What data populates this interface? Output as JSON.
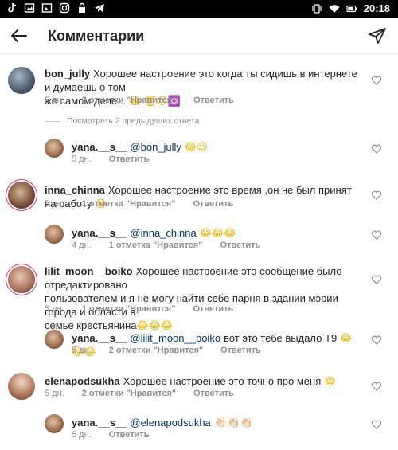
{
  "status_bar": {
    "time": "20:18",
    "icons": [
      "tiktok-icon",
      "gallery-icon",
      "picture-icon",
      "instagram-icon",
      "lock-icon",
      "telegram-icon"
    ],
    "right_icons": [
      "vibrate-icon",
      "wifi-icon",
      "battery-icon"
    ]
  },
  "header": {
    "title": "Комментарии"
  },
  "view_previous": "Посмотреть 2 предыдущих ответа",
  "comments": [
    {
      "user": "bon_jully",
      "text": "Хорошее настроение это когда ты сидишь в интернете и думаешь о том",
      "text2": "же самом деле...",
      "emoji": "😂 🗑😕🔯",
      "time": "5 дн.",
      "likes": "2 отметки \"Нравится\"",
      "reply": "Ответить"
    },
    {
      "user": "yana.__s__",
      "mention": "@bon_jully",
      "emoji": "😂😉",
      "time": "5 дн.",
      "reply": "Ответить"
    },
    {
      "user": "inna_chinna",
      "text": "Хорошее настроение это время ,он не был принят на работу",
      "emoji": "😂",
      "time": "5 дн.",
      "likes": "1 отметка \"Нравится\"",
      "reply": "Ответить"
    },
    {
      "user": "yana.__s__",
      "mention": "@inna_chinna",
      "emoji": "😂😂😂",
      "time": "4 дн.",
      "likes": "1 отметка \"Нравится\"",
      "reply": "Ответить"
    },
    {
      "user": "lilit_moon__boiko",
      "text": "Хорошее настроение это сообщение было отредактировано",
      "text2": "пользователем и я не могу найти себе парня в здании мэрии города и области в",
      "text3": "семье крестьянина",
      "emoji": "😂😂😂",
      "time": "5 дн.",
      "likes": "1 отметка \"Нравится\"",
      "reply": "Ответить"
    },
    {
      "user": "yana.__s__",
      "mention": "@lilit_moon__boiko",
      "text": "вот это тебе выдало Т9",
      "emoji": "😂😂😂",
      "time": "5 дн.",
      "likes": "2 отметки \"Нравится\"",
      "reply": "Ответить"
    },
    {
      "user": "elenapodsukha",
      "text": "Хорошее настроение это точно про меня",
      "emoji": "😂",
      "time": "5 дн.",
      "likes": "2 отметки \"Нравится\"",
      "reply": "Ответить"
    },
    {
      "user": "yana.__s__",
      "mention": "@elenapodsukha",
      "emoji": "👏🏻👏🏻👏🏻",
      "time": "5 дн.",
      "reply": "Ответить"
    }
  ]
}
